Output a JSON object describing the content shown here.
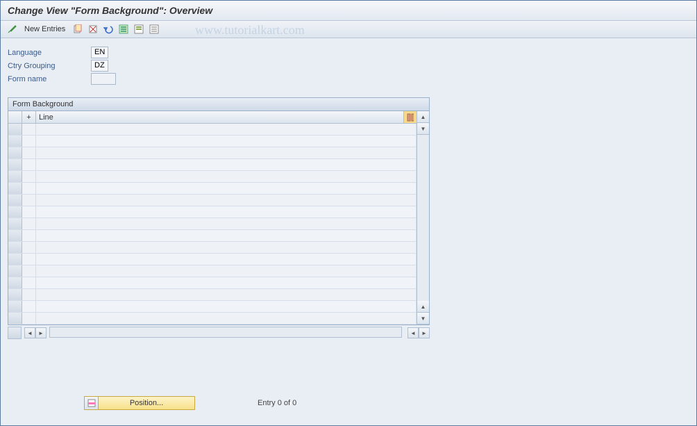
{
  "header": {
    "title": "Change View \"Form Background\": Overview"
  },
  "toolbar": {
    "new_entries": "New Entries"
  },
  "watermark": "www.tutorialkart.com",
  "fields": {
    "language_label": "Language",
    "language_value": "EN",
    "ctry_grouping_label": "Ctry Grouping",
    "ctry_grouping_value": "DZ",
    "form_name_label": "Form name",
    "form_name_value": ""
  },
  "table": {
    "title": "Form Background",
    "col_plus": "+",
    "col_line": "Line"
  },
  "footer": {
    "position_button": "Position...",
    "entry_status": "Entry 0 of 0"
  }
}
